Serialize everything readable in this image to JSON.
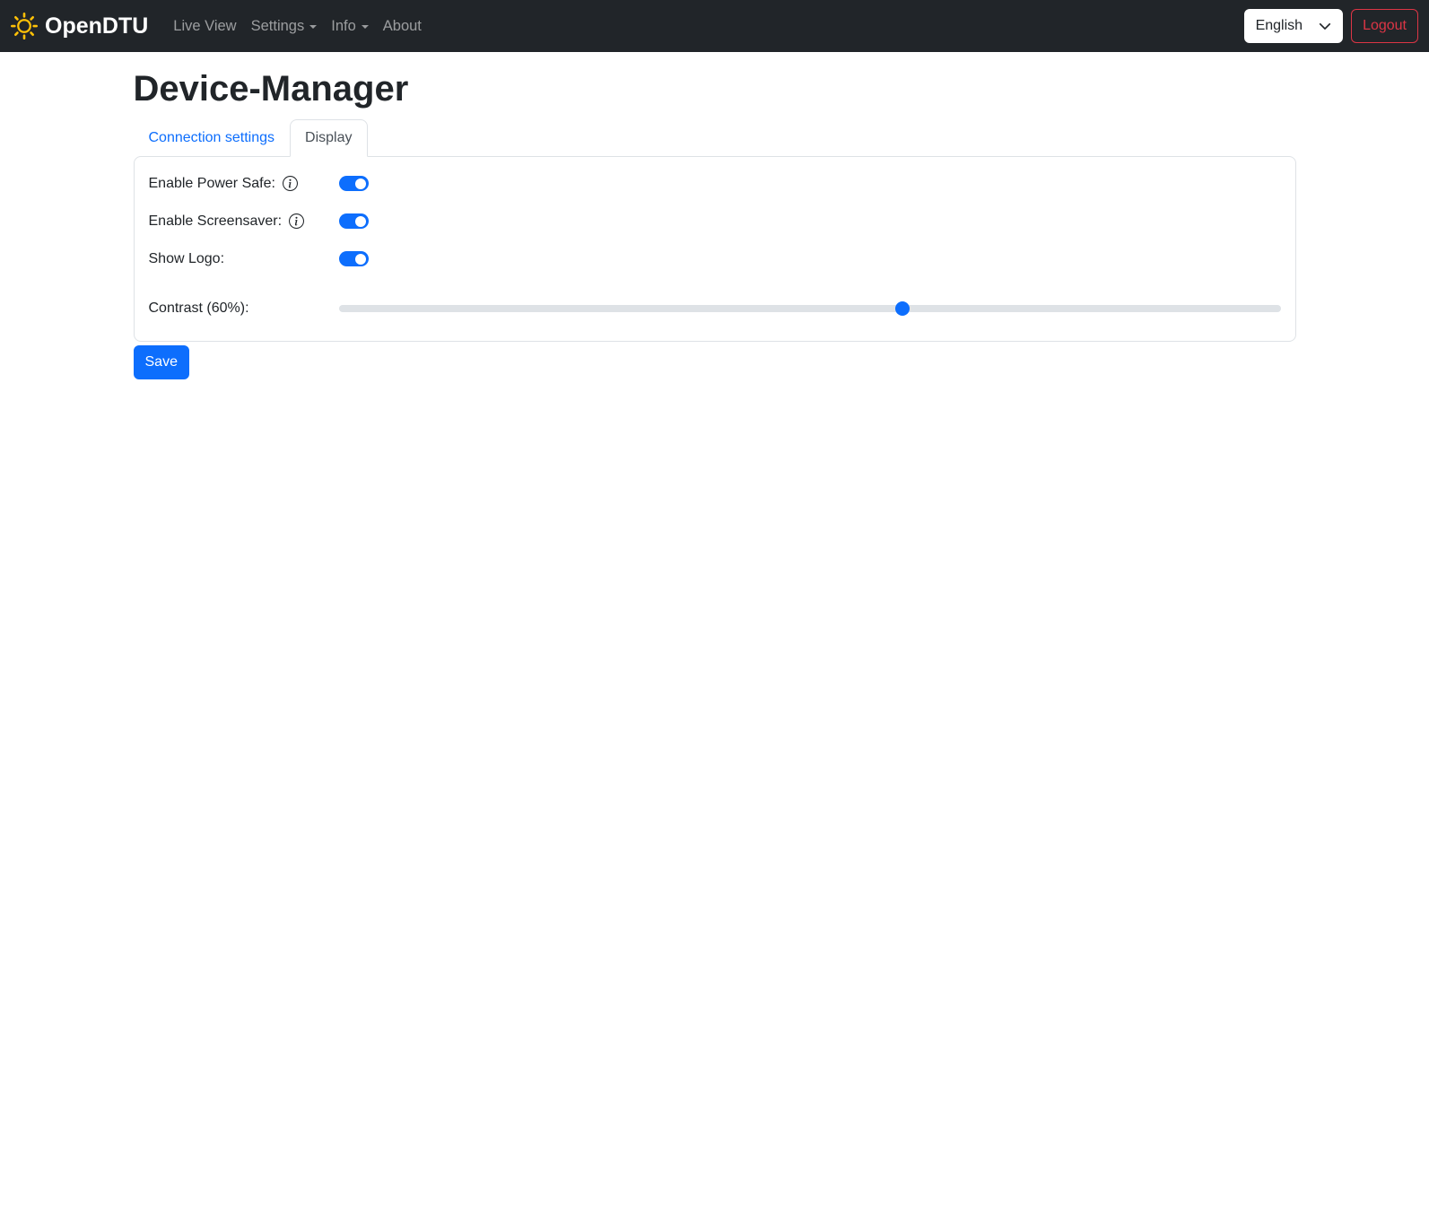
{
  "navbar": {
    "brand": "OpenDTU",
    "items": [
      {
        "label": "Live View",
        "dropdown": false
      },
      {
        "label": "Settings",
        "dropdown": true
      },
      {
        "label": "Info",
        "dropdown": true
      },
      {
        "label": "About",
        "dropdown": false
      }
    ],
    "language": "English",
    "logout_label": "Logout"
  },
  "page": {
    "title": "Device-Manager",
    "tabs": [
      {
        "label": "Connection settings",
        "active": false
      },
      {
        "label": "Display",
        "active": true
      }
    ]
  },
  "settings": {
    "rows": [
      {
        "label": "Enable Power Safe:",
        "type": "switch",
        "info": true,
        "value": true
      },
      {
        "label": "Enable Screensaver:",
        "type": "switch",
        "info": true,
        "value": true
      },
      {
        "label": "Show Logo:",
        "type": "switch",
        "info": false,
        "value": true
      },
      {
        "label": "Contrast (60%):",
        "type": "range",
        "info": false,
        "value": 60,
        "min": 0,
        "max": 100
      }
    ],
    "save_label": "Save"
  },
  "icons": {
    "brand": "sun-icon",
    "info": "info-circle-icon",
    "language": "chevron-down-icon",
    "nav_dropdown": "caret-down-icon"
  },
  "colors": {
    "navbar_bg": "#212529",
    "accent_blue": "#0d6efd",
    "brand_yellow": "#ffc107",
    "danger_red": "#dc3545",
    "border_gray": "#dee2e6",
    "text_dark": "#212529"
  }
}
